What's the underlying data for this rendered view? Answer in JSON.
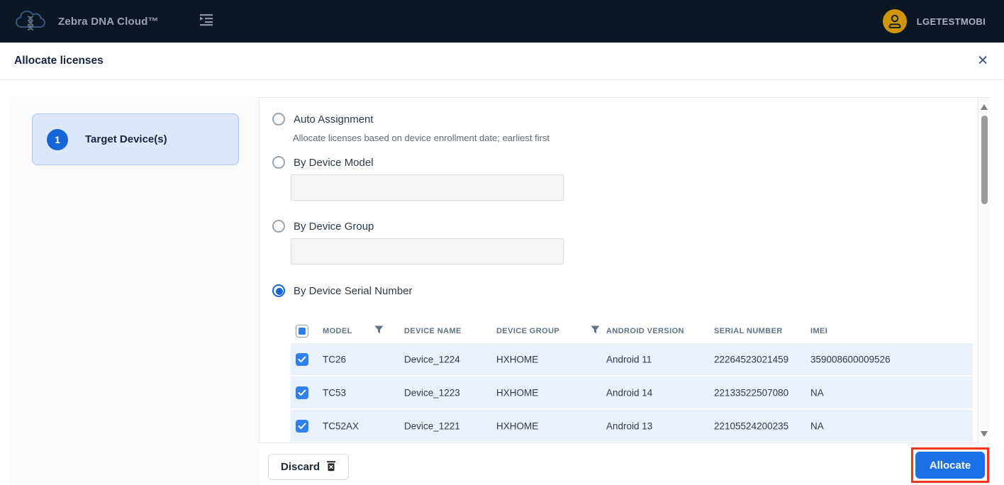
{
  "app_bar": {
    "title": "Zebra DNA Cloud™",
    "username": "LGETESTMOBI"
  },
  "dialog": {
    "title": "Allocate licenses",
    "close_glyph": "✕"
  },
  "steps": [
    {
      "number": "1",
      "label": "Target Device(s)"
    }
  ],
  "options": [
    {
      "label": "Auto Assignment",
      "description": "Allocate licenses based on device enrollment date; earliest first",
      "selected": false
    },
    {
      "label": "By Device Model",
      "selected": false,
      "input_value": ""
    },
    {
      "label": "By Device Group",
      "selected": false,
      "input_value": ""
    },
    {
      "label": "By Device Serial Number",
      "selected": true
    }
  ],
  "table": {
    "headers": [
      "MODEL",
      "DEVICE NAME",
      "DEVICE GROUP",
      "ANDROID VERSION",
      "SERIAL NUMBER",
      "IMEI"
    ],
    "select_all_state": "indeterminate",
    "rows": [
      {
        "checked": true,
        "model": "TC26",
        "device_name": "Device_1224",
        "device_group": "HXHOME",
        "android_version": "Android 11",
        "serial_number": "22264523021459",
        "imei": "359008600009526"
      },
      {
        "checked": true,
        "model": "TC53",
        "device_name": "Device_1223",
        "device_group": "HXHOME",
        "android_version": "Android 14",
        "serial_number": "22133522507080",
        "imei": "NA"
      },
      {
        "checked": true,
        "model": "TC52AX",
        "device_name": "Device_1221",
        "device_group": "HXHOME",
        "android_version": "Android 13",
        "serial_number": "22105524200235",
        "imei": "NA"
      }
    ]
  },
  "footer": {
    "discard_label": "Discard",
    "allocate_label": "Allocate"
  },
  "icons": {
    "logo": "cloud-dna-icon",
    "collapse": "collapse-sidebar-icon",
    "avatar": "user-icon",
    "close": "close-icon",
    "filter": "filter-funnel-icon",
    "trash": "trash-icon",
    "scroll_up": "scroll-up-arrow-icon",
    "scroll_down": "scroll-down-arrow-icon"
  },
  "colors": {
    "appbar_bg": "#0b1723",
    "accent_blue": "#1a73e8",
    "checkbox_blue": "#2f80ed",
    "selected_row_bg": "#e9f1fd",
    "step_card_bg": "#dbe8fa",
    "step_card_border": "#a6c5ef",
    "avatar_bg": "#cf9600",
    "highlight_outline": "#f1381c"
  }
}
